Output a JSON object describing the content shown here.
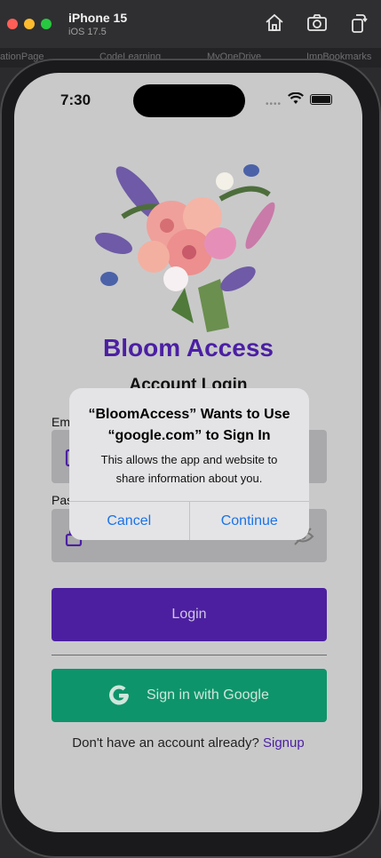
{
  "simulator": {
    "device_name": "iPhone 15",
    "os_version": "iOS 17.5",
    "bookmarks": [
      "ationPage",
      "CodeLearning",
      "MyOneDrive",
      "ImpBookmarks"
    ]
  },
  "status_bar": {
    "time": "7:30",
    "dots": "••••"
  },
  "app": {
    "title": "Bloom Access",
    "heading": "Account Login",
    "email_label": "Email",
    "password_label": "Password",
    "login_button": "Login",
    "google_button": "Sign in with Google",
    "signup_prompt": "Don't have an account already?",
    "signup_link": "Signup"
  },
  "alert": {
    "title": "“BloomAccess” Wants to Use “google.com” to Sign In",
    "message": "This allows the app and website to share information about you.",
    "cancel": "Cancel",
    "continue": "Continue"
  },
  "colors": {
    "brand_purple": "#4b1fa3",
    "google_green": "#0e946a",
    "alert_link": "#1a73e8"
  }
}
